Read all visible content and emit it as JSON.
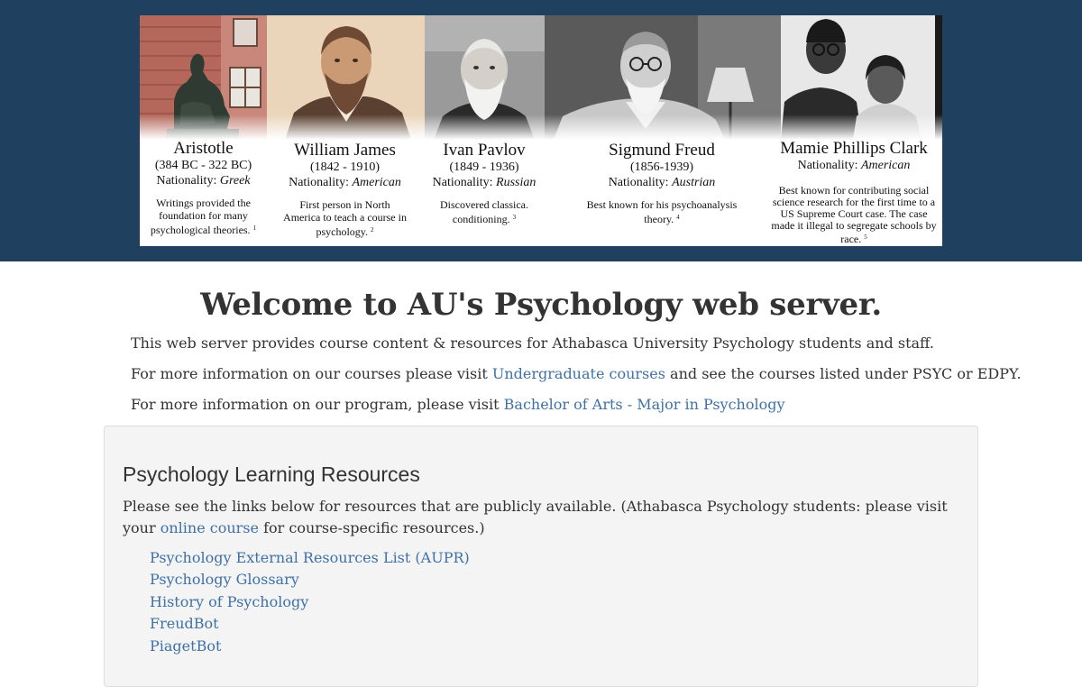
{
  "banner": {
    "people": [
      {
        "name": "Aristotle",
        "dates": "(384 BC - 322 BC)",
        "nationality_label": "Nationality:",
        "nationality": "Greek",
        "description": "Writings provided the foundation for many psychological theories.",
        "footnote": "1"
      },
      {
        "name": "William James",
        "dates": "(1842 - 1910)",
        "nationality_label": "Nationality:",
        "nationality": "American",
        "description": "First person in North America to teach a course in psychology.",
        "footnote": "2"
      },
      {
        "name": "Ivan Pavlov",
        "dates": "(1849 - 1936)",
        "nationality_label": "Nationality:",
        "nationality": "Russian",
        "description": "Discovered classica. conditioning.",
        "footnote": "3"
      },
      {
        "name": "Sigmund Freud",
        "dates": "(1856-1939)",
        "nationality_label": "Nationality:",
        "nationality": "Austrian",
        "description": "Best known for his psychoanalysis theory.",
        "footnote": "4"
      },
      {
        "name": "Mamie Phillips Clark",
        "dates": "",
        "nationality_label": "Nationality:",
        "nationality": "American",
        "description": "Best known for contributing social science research for the first time to a US Supreme Court case. The case made it illegal to segregate schools by race.",
        "footnote": "5"
      }
    ]
  },
  "heading": {
    "prefix": "Welcome to AU's ",
    "bold": "Psychology",
    "suffix": " web server."
  },
  "intro": {
    "line1": "This web server provides course content & resources for Athabasca University Psychology students and staff.",
    "line2_before": "For more information on our courses please visit ",
    "line2_link": "Undergraduate courses",
    "line2_after": " and see the courses listed under PSYC or EDPY.",
    "line3_before": "For more information on our program, please visit ",
    "line3_link": "Bachelor of Arts - Major in Psychology"
  },
  "resources": {
    "title": "Psychology Learning Resources",
    "text_before": "Please see the links below for resources that are publicly available. (Athabasca Psychology students: please visit your ",
    "text_link": "online course",
    "text_after": " for course-specific resources.)",
    "links": [
      "Psychology External Resources List (AUPR)",
      "Psychology Glossary",
      "History of Psychology",
      "FreudBot",
      "PiagetBot"
    ]
  },
  "colors": {
    "band": "#20405f",
    "link": "#3f71a6",
    "panel": "#f4f4f4"
  }
}
